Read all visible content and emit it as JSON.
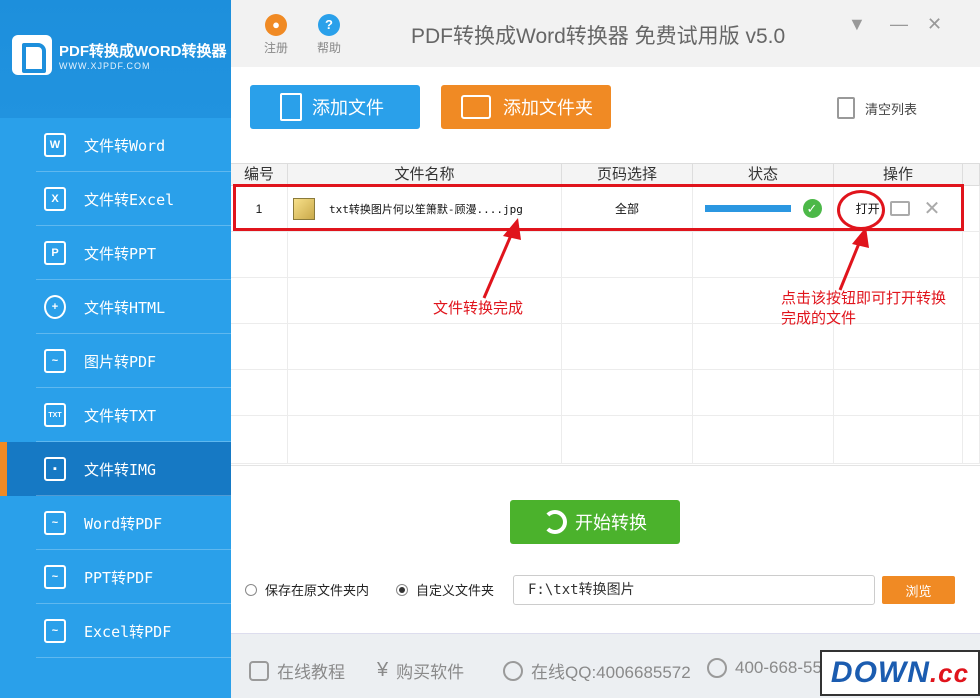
{
  "app": {
    "logo_title": "PDF转换成WORD转换器",
    "logo_url": "WWW.XJPDF.COM",
    "title": "PDF转换成Word转换器 免费试用版 v5.0",
    "register_label": "注册",
    "help_label": "帮助"
  },
  "sidebar": {
    "items": [
      {
        "label": "文件转Word",
        "icon": "W"
      },
      {
        "label": "文件转Excel",
        "icon": "X"
      },
      {
        "label": "文件转PPT",
        "icon": "P"
      },
      {
        "label": "文件转HTML",
        "icon": "globe"
      },
      {
        "label": "图片转PDF",
        "icon": "pdf"
      },
      {
        "label": "文件转TXT",
        "icon": "TXT"
      },
      {
        "label": "文件转IMG",
        "icon": "img",
        "active": true
      },
      {
        "label": "Word转PDF",
        "icon": "pdf"
      },
      {
        "label": "PPT转PDF",
        "icon": "pdf"
      },
      {
        "label": "Excel转PDF",
        "icon": "pdf"
      }
    ]
  },
  "toolbar": {
    "add_file": "添加文件",
    "add_folder": "添加文件夹",
    "clear_list": "清空列表"
  },
  "table": {
    "headers": [
      "编号",
      "文件名称",
      "页码选择",
      "状态",
      "操作"
    ],
    "rows": [
      {
        "index": "1",
        "file_name": "txt转换图片何以笙箫默-顾漫....jpg",
        "pages": "全部",
        "progress": 1.0,
        "action": "打开"
      }
    ]
  },
  "annotations": {
    "done": "文件转换完成",
    "open_hint_line1": "点击该按钮即可打开转换",
    "open_hint_line2": "完成的文件"
  },
  "bottom": {
    "start_label": "开始转换",
    "option_original": "保存在原文件夹内",
    "option_custom": "自定义文件夹",
    "selected_option": "custom",
    "path_value": "F:\\txt转换图片",
    "browse_label": "浏览"
  },
  "footer": {
    "tutorial": "在线教程",
    "buy": "购买软件",
    "qq": "在线QQ:4006685572",
    "phone": "400-668-55"
  },
  "watermark": {
    "main": "DOWN",
    "suffix": ".cc"
  },
  "colors": {
    "sidebar": "#2aa0ea",
    "active": "#1679c4",
    "accent_orange": "#f08a24",
    "start_green": "#4bb22c",
    "annotation_red": "#e0141c"
  }
}
